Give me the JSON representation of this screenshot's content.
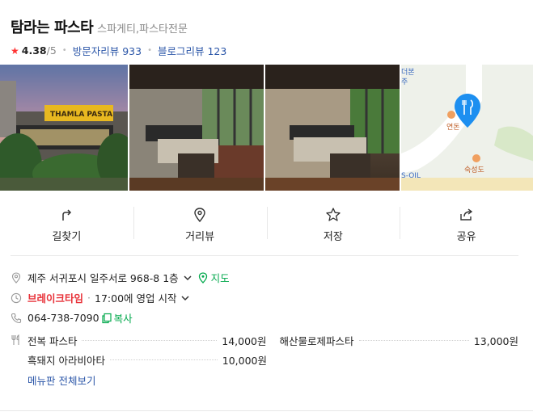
{
  "place": {
    "name": "탐라는 파스타",
    "category": "스파게티,파스타전문",
    "rating": "4.38",
    "rating_max": "/5",
    "visitor_review_label": "방문자리뷰",
    "visitor_review_count": "933",
    "blog_review_label": "블로그리뷰",
    "blog_review_count": "123"
  },
  "photos": {
    "sign_text": "THAMLA PASTA",
    "map_labels": {
      "top": "더본\n주",
      "restaurant": "연돈",
      "station": "S-OIL",
      "lodging": "숙성도"
    }
  },
  "actions": [
    {
      "label": "길찾기",
      "icon": "directions-icon"
    },
    {
      "label": "거리뷰",
      "icon": "street-view-icon"
    },
    {
      "label": "저장",
      "icon": "star-outline-icon"
    },
    {
      "label": "공유",
      "icon": "share-icon"
    }
  ],
  "info": {
    "address": "제주 서귀포시 일주서로 968-8 1층",
    "map_link": "지도",
    "break_time": "브레이크타임",
    "hours_text": "17:00에 영업 시작",
    "phone": "064-738-7090",
    "copy_label": "복사"
  },
  "menu": {
    "items": [
      {
        "name": "전복 파스타",
        "price": "14,000원"
      },
      {
        "name": "해산물로제파스타",
        "price": "13,000원"
      },
      {
        "name": "흑돼지 아라비아타",
        "price": "10,000원"
      }
    ],
    "see_all": "메뉴판 전체보기"
  },
  "colors": {
    "accent_green": "#03a94d",
    "link_blue": "#2b56a8",
    "break_red": "#e8333a",
    "pin_blue": "#1d8ff0"
  }
}
